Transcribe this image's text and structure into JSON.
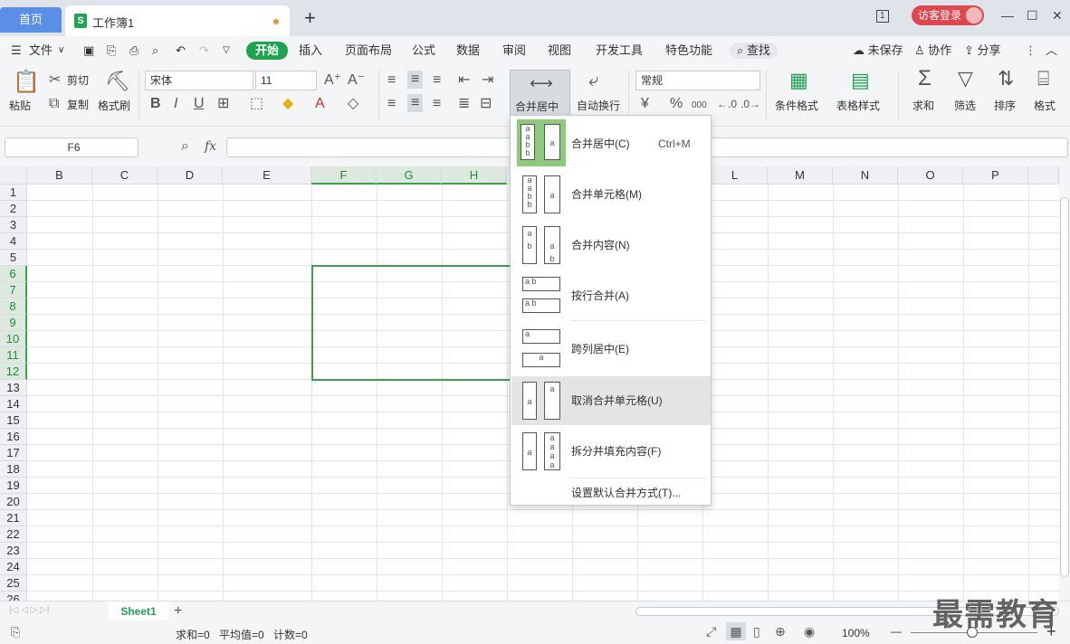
{
  "titlebar": {
    "home_tab": "首页",
    "doc_tab": "工作簿1",
    "doc_icon": "S",
    "new_tab": "+",
    "login": "访客登录",
    "page_indicator": "1",
    "minimize": "—",
    "maximize": "☐",
    "close": "✕"
  },
  "menu": {
    "file": "文件",
    "tabs": [
      "开始",
      "插入",
      "页面布局",
      "公式",
      "数据",
      "审阅",
      "视图",
      "开发工具",
      "特色功能"
    ],
    "search": "查找",
    "unsaved": "未保存",
    "collab": "协作",
    "share": "分享"
  },
  "ribbon": {
    "paste": "粘贴",
    "cut": "剪切",
    "copy": "复制",
    "format_painter": "格式刷",
    "font_name": "宋体",
    "font_size": "11",
    "bold": "B",
    "italic": "I",
    "underline": "U",
    "merge_center": "合并居中",
    "wrap_text": "自动换行",
    "number_format": "常规",
    "currency": "¥",
    "percent": "%",
    "thousands": "000",
    "cond_format": "条件格式",
    "table_style": "表格样式",
    "sum": "求和",
    "filter": "筛选",
    "sort": "排序",
    "format": "格式"
  },
  "formula_bar": {
    "name_box": "F6",
    "fx": "fx",
    "value": ""
  },
  "grid": {
    "columns": [
      "B",
      "C",
      "D",
      "E",
      "F",
      "G",
      "H",
      "I",
      "J",
      "K",
      "L",
      "M",
      "N",
      "O",
      "P"
    ],
    "rows": [
      "1",
      "2",
      "3",
      "4",
      "5",
      "6",
      "7",
      "8",
      "9",
      "10",
      "11",
      "12",
      "13",
      "14",
      "15",
      "16",
      "17",
      "18",
      "19",
      "20",
      "21",
      "22",
      "23",
      "24",
      "25",
      "26"
    ],
    "selected_columns": [
      "F",
      "G",
      "H"
    ],
    "selected_rows": [
      "6",
      "7",
      "8",
      "9",
      "10",
      "11",
      "12"
    ]
  },
  "merge_menu": {
    "items": [
      {
        "label": "合并居中(C)",
        "shortcut": "Ctrl+M"
      },
      {
        "label": "合并单元格(M)",
        "shortcut": ""
      },
      {
        "label": "合并内容(N)",
        "shortcut": ""
      },
      {
        "label": "按行合并(A)",
        "shortcut": ""
      },
      {
        "label": "跨列居中(E)",
        "shortcut": ""
      },
      {
        "label": "取消合并单元格(U)",
        "shortcut": ""
      },
      {
        "label": "拆分并填充内容(F)",
        "shortcut": ""
      },
      {
        "label": "设置默认合并方式(T)...",
        "shortcut": ""
      }
    ],
    "highlighted_index": 5
  },
  "sheets": {
    "active": "Sheet1",
    "add": "+"
  },
  "status": {
    "sum": "求和=0",
    "avg": "平均值=0",
    "count": "计数=0",
    "zoom": "100%",
    "zoom_minus": "—",
    "zoom_plus": "+",
    "zoom_level": 1.0
  },
  "watermark": "最需教育",
  "colors": {
    "accent_green": "#1ea34e",
    "selection_green": "#3aa34c",
    "home_tab_blue": "#5b8ee6",
    "login_red": "#e0474c"
  }
}
